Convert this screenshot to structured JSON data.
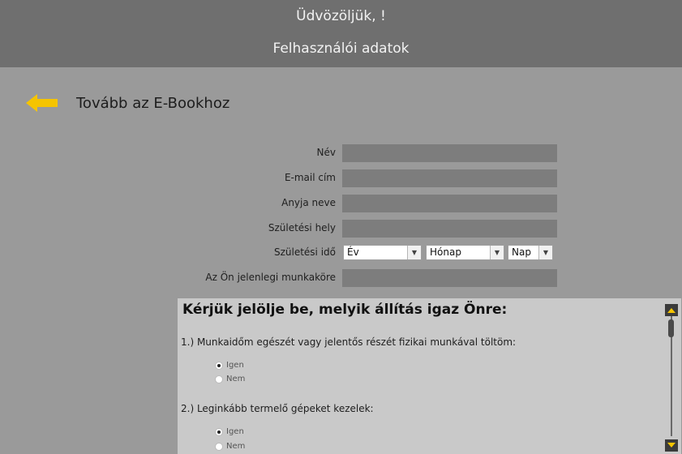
{
  "header": {
    "welcome": "Üdvözöljük, !",
    "subtitle": "Felhasználói adatok"
  },
  "back": {
    "label": "Tovább az E-Bookhoz",
    "icon": "arrow-left-icon",
    "icon_color": "#f5c400"
  },
  "form": {
    "name_label": "Név",
    "name_value": "",
    "email_label": "E-mail cím",
    "email_value": "",
    "mother_label": "Anyja neve",
    "mother_value": "",
    "birthplace_label": "Születési hely",
    "birthplace_value": "",
    "birthdate_label": "Születési idő",
    "year_select": "Év",
    "month_select": "Hónap",
    "day_select": "Nap",
    "job_label": "Az Ön jelenlegi munkaköre",
    "job_value": ""
  },
  "survey": {
    "title": "Kérjük jelölje be, melyik állítás igaz Önre:",
    "questions": [
      {
        "text": "1.) Munkaidőm egészét vagy jelentős részét fizikai munkával töltöm:",
        "options": [
          {
            "label": "Igen",
            "selected": true
          },
          {
            "label": "Nem",
            "selected": false
          }
        ]
      },
      {
        "text": "2.) Leginkább termelő gépeket kezelek:",
        "options": [
          {
            "label": "Igen",
            "selected": true
          },
          {
            "label": "Nem",
            "selected": false
          }
        ]
      }
    ]
  },
  "colors": {
    "background": "#9a9a9a",
    "header": "#6f6f6f",
    "field": "#7d7d7d",
    "panel": "#c9c9c9",
    "accent": "#f5c400"
  }
}
